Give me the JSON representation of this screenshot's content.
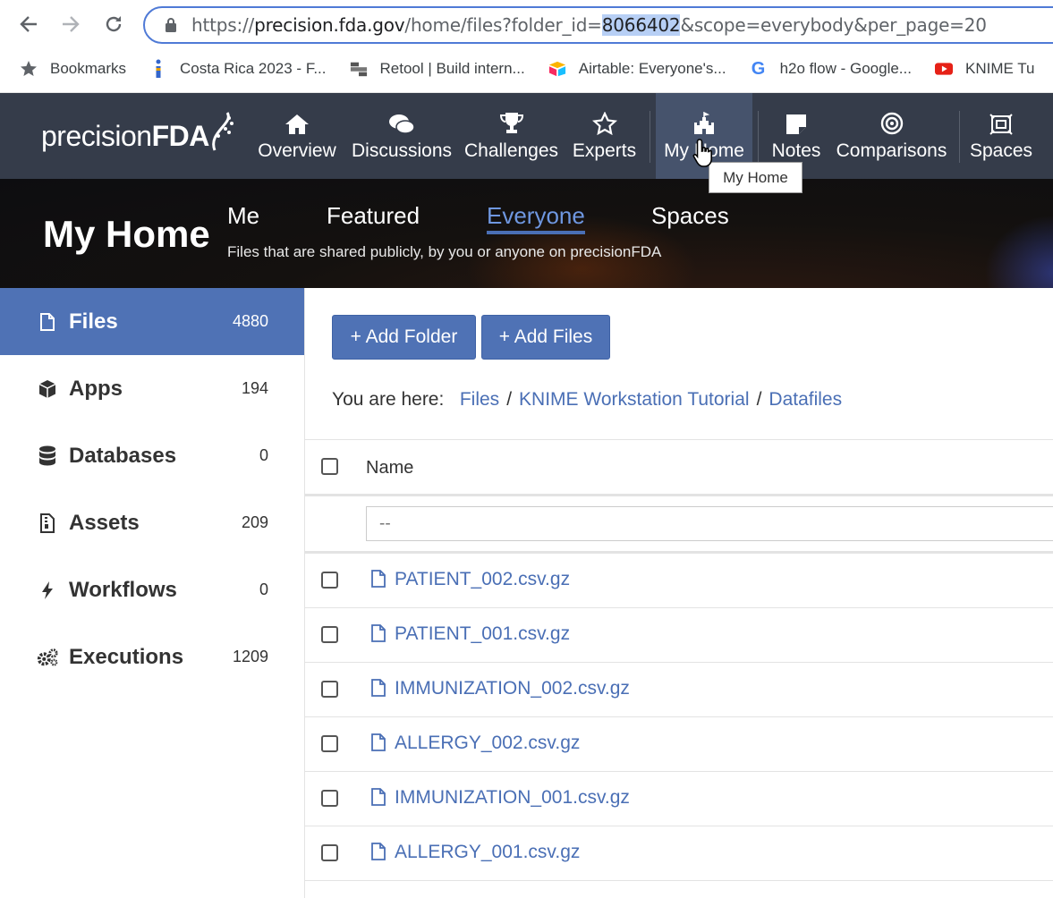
{
  "browser": {
    "url_prefix": "https://",
    "url_host": "precision.fda.gov",
    "url_path": "/home/files?folder_id=",
    "url_highlight": "8066402",
    "url_rest": "&scope=everybody&per_page=20",
    "bookmarks": [
      {
        "label": "Bookmarks",
        "icon": "star-icon"
      },
      {
        "label": "Costa Rica 2023 - F...",
        "icon": "info-icon"
      },
      {
        "label": "Retool | Build intern...",
        "icon": "retool-icon"
      },
      {
        "label": "Airtable: Everyone's...",
        "icon": "airtable-icon"
      },
      {
        "label": "h2o flow - Google...",
        "icon": "google-icon"
      },
      {
        "label": "KNIME Tu",
        "icon": "youtube-icon"
      }
    ]
  },
  "navbar": {
    "logo_light": "precision",
    "logo_bold": "FDA",
    "items": [
      {
        "label": "Overview",
        "icon": "home-icon"
      },
      {
        "label": "Discussions",
        "icon": "comments-icon"
      },
      {
        "label": "Challenges",
        "icon": "trophy-icon"
      },
      {
        "label": "Experts",
        "icon": "star-icon"
      },
      {
        "label": "My Home",
        "icon": "castle-icon"
      },
      {
        "label": "Notes",
        "icon": "note-icon"
      },
      {
        "label": "Comparisons",
        "icon": "target-icon"
      },
      {
        "label": "Spaces",
        "icon": "spaces-icon"
      }
    ],
    "tooltip": "My Home"
  },
  "hero": {
    "title": "My Home",
    "tabs": [
      "Me",
      "Featured",
      "Everyone",
      "Spaces"
    ],
    "active_tab": "Everyone",
    "subtitle": "Files that are shared publicly, by you or anyone on precisionFDA"
  },
  "sidebar": {
    "items": [
      {
        "label": "Files",
        "count": "4880",
        "icon": "file-icon"
      },
      {
        "label": "Apps",
        "count": "194",
        "icon": "cube-icon"
      },
      {
        "label": "Databases",
        "count": "0",
        "icon": "database-icon"
      },
      {
        "label": "Assets",
        "count": "209",
        "icon": "asset-icon"
      },
      {
        "label": "Workflows",
        "count": "0",
        "icon": "bolt-icon"
      },
      {
        "label": "Executions",
        "count": "1209",
        "icon": "cogs-icon"
      }
    ]
  },
  "main": {
    "add_folder": "+ Add Folder",
    "add_files": "+ Add Files",
    "crumb_prefix": "You are here:",
    "crumbs": [
      "Files",
      "KNIME Workstation Tutorial",
      "Datafiles"
    ],
    "crumb_sep": "/",
    "column_name": "Name",
    "filter_placeholder": "--",
    "files": [
      "PATIENT_002.csv.gz",
      "PATIENT_001.csv.gz",
      "IMMUNIZATION_002.csv.gz",
      "ALLERGY_002.csv.gz",
      "IMMUNIZATION_001.csv.gz",
      "ALLERGY_001.csv.gz"
    ]
  },
  "colors": {
    "navbar_bg": "#353c4a",
    "active_blue": "#4f72b5",
    "link_blue": "#4a6fb5"
  }
}
